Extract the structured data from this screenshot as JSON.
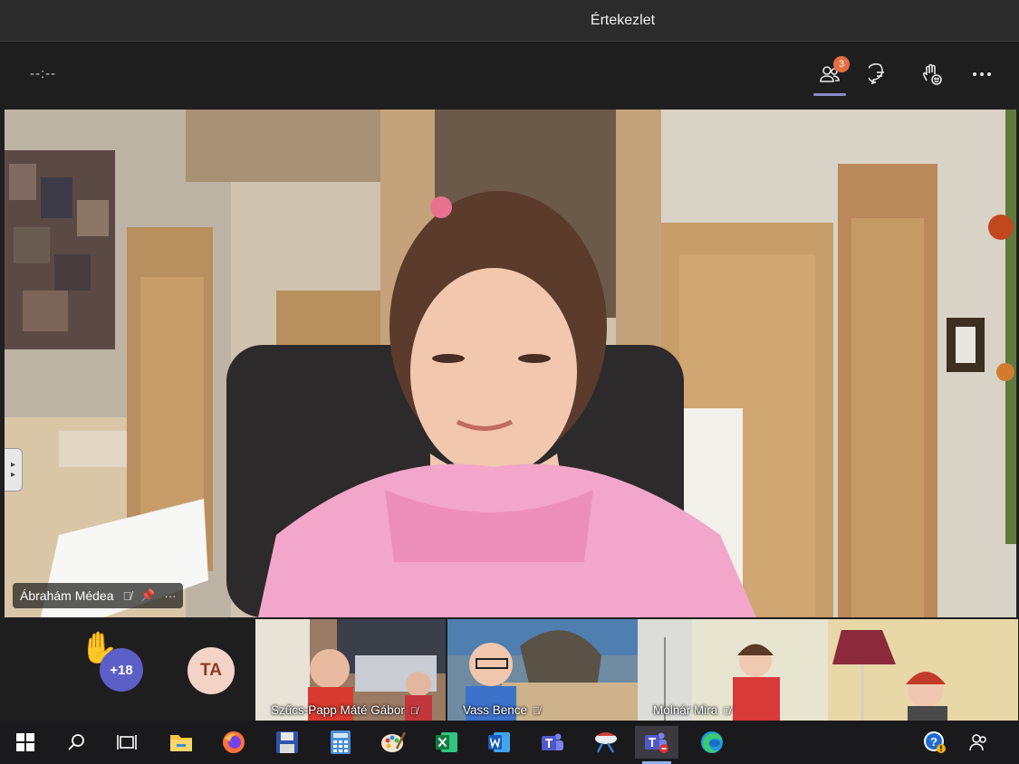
{
  "window": {
    "title": "Értekezlet"
  },
  "toolbar": {
    "timer": "--:--",
    "participants_badge": "3",
    "participants_icon": "people-icon",
    "chat_icon": "chat-icon",
    "reactions_icon": "raise-hand-icon",
    "more_icon": "more-icon",
    "active_color": "#8b8cc7",
    "badge_color": "#e56d43"
  },
  "main_video": {
    "participant_name": "Ábrahám Médea"
  },
  "strip": {
    "overflow_count": "+18",
    "avatar_initials": "TA",
    "tiles": [
      {
        "name": "Szűcs-Papp Máté Gábor"
      },
      {
        "name": "Vass Bence"
      },
      {
        "name": "Molnár Mira"
      },
      {
        "name": ""
      }
    ]
  },
  "taskbar": {
    "items": [
      "windows-start-icon",
      "search-icon",
      "task-view-icon",
      "file-explorer-icon",
      "firefox-icon",
      "save-app-icon",
      "calculator-icon",
      "paint-icon",
      "excel-icon",
      "word-icon",
      "teams-icon",
      "snip-icon",
      "teams-active-icon",
      "edge-icon"
    ],
    "tray": [
      "help-icon",
      "people-icon"
    ]
  }
}
